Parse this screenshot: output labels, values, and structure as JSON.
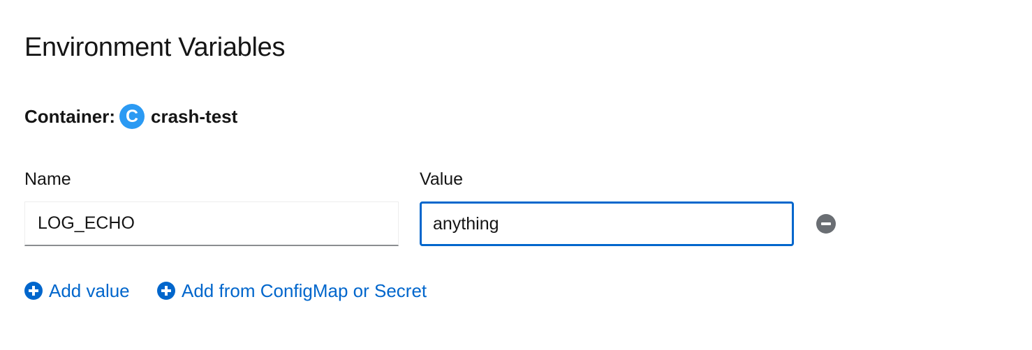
{
  "page": {
    "title": "Environment Variables"
  },
  "container": {
    "label": "Container:",
    "badge_letter": "C",
    "name": "crash-test",
    "badge_color": "#2b9af3"
  },
  "env_table": {
    "name_header": "Name",
    "value_header": "Value",
    "rows": [
      {
        "name": "LOG_ECHO",
        "value": "anything"
      }
    ]
  },
  "actions": {
    "add_value_label": "Add value",
    "add_from_label": "Add from ConfigMap or Secret"
  },
  "icons": {
    "remove": "minus-circle-icon",
    "add": "plus-circle-icon"
  },
  "colors": {
    "link": "#0066cc",
    "focus_border": "#0066cc",
    "remove_icon": "#6a6e73"
  }
}
